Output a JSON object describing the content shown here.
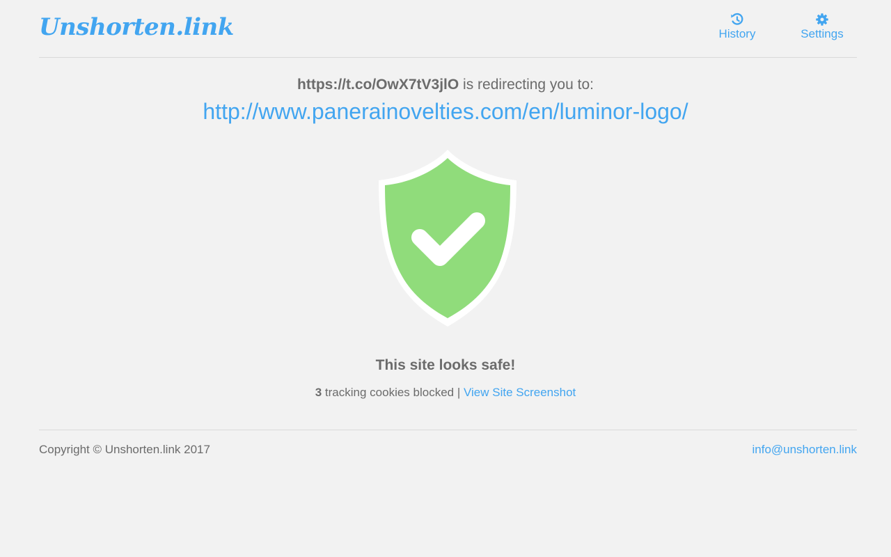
{
  "header": {
    "logo_text": "Unshorten.link",
    "nav": {
      "history_label": "History",
      "history_icon": "history-icon",
      "settings_label": "Settings",
      "settings_icon": "gear-icon"
    }
  },
  "result": {
    "short_url": "https://t.co/OwX7tV3jlO",
    "redirect_text": " is redirecting you to:",
    "destination_url": "http://www.panerainovelties.com/en/luminor-logo/",
    "status_icon": "shield-check-icon",
    "verdict": "This site looks safe!",
    "cookies_blocked_count": "3",
    "cookies_blocked_text": " tracking cookies blocked | ",
    "screenshot_link": "View Site Screenshot"
  },
  "colors": {
    "accent": "#42a5f0",
    "text": "#6b6b6b",
    "safe_green": "#90dc7b",
    "background": "#f2f2f2"
  },
  "footer": {
    "copyright": "Copyright © Unshorten.link 2017",
    "email": "info@unshorten.link"
  }
}
